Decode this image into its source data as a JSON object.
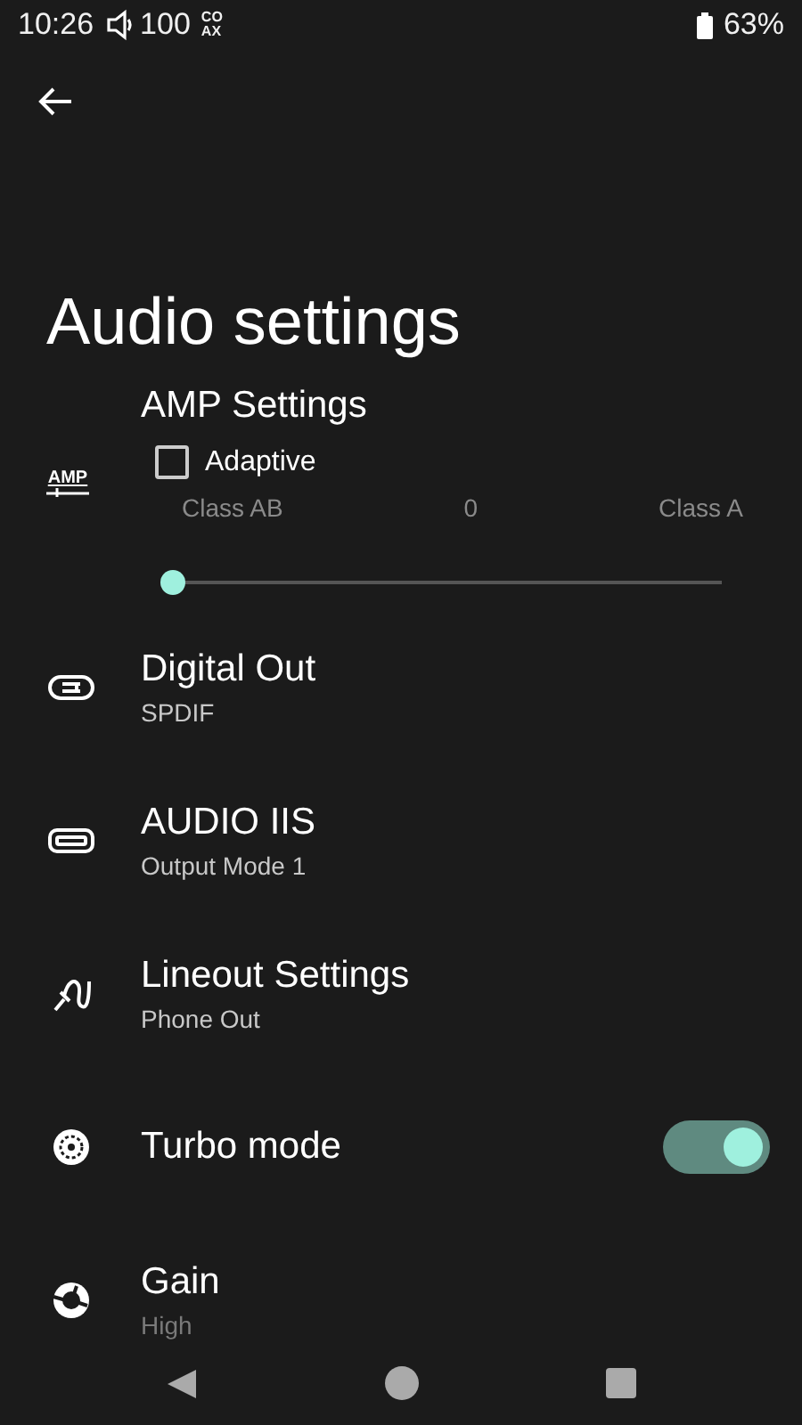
{
  "status_bar": {
    "time": "10:26",
    "volume": "100",
    "output_badge": [
      "CO",
      "AX"
    ],
    "battery": "63%"
  },
  "title": "Audio settings",
  "amp": {
    "icon_text": "AMP",
    "title": "AMP Settings",
    "adaptive": {
      "label": "Adaptive",
      "checked": false
    },
    "slider": {
      "min_label": "Class AB",
      "value": "0",
      "max_label": "Class A",
      "level": 0
    }
  },
  "items": [
    {
      "kind": "nav",
      "title": "Digital Out",
      "subtitle": "SPDIF"
    },
    {
      "kind": "nav",
      "title": "AUDIO IIS",
      "subtitle": "Output Mode 1"
    },
    {
      "kind": "nav",
      "title": "Lineout Settings",
      "subtitle": "Phone Out"
    },
    {
      "kind": "switch",
      "title": "Turbo mode",
      "on": true
    },
    {
      "kind": "nav",
      "title": "Gain",
      "subtitle": "High"
    }
  ]
}
